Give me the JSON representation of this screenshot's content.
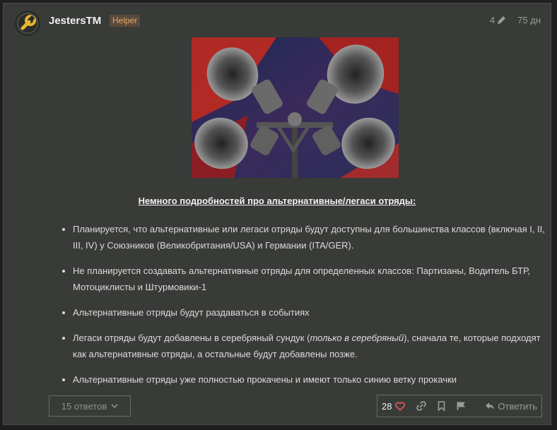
{
  "post": {
    "username": "JestersTM",
    "badge": "Helper",
    "edit_count": "4",
    "age": "75 дн",
    "heading": "Немного подробностей про альтернативные/легаси отряды:",
    "points": [
      {
        "text": "Планируется, что альтернативные или легаси отряды будут доступны для большинства классов (включая I, II, III, IV) у Союзников (Великобритания/USA) и Германии (ITA/GER)."
      },
      {
        "text": "Не планируется создавать альтернативные отряды для определенных классов: Партизаны, Водитель БТР, Мотоциклисты и Штурмовики-1"
      },
      {
        "text": "Альтернативные отряды будут раздаваться в событиях"
      },
      {
        "before": "Легаси отряды будут добавлены в серебряный сундук (",
        "italic": "только в серебряный",
        "after": "), сначала те, которые подходят как альтернативные отряды, а остальные будут добавлены позже."
      },
      {
        "text": "Альтернативные отряды уже полностью прокачены и имеют только синию ветку прокачки"
      }
    ]
  },
  "footer": {
    "replies_label": "15 ответов",
    "like_count": "28",
    "reply_label": "Ответить"
  },
  "colors": {
    "background": "#393b38",
    "accent_badge": "#e2a86a",
    "like_heart": "#e45a5a"
  },
  "icons": [
    "pencil-icon",
    "chevron-down-icon",
    "heart-icon",
    "link-icon",
    "bookmark-icon",
    "flag-icon",
    "reply-icon"
  ]
}
